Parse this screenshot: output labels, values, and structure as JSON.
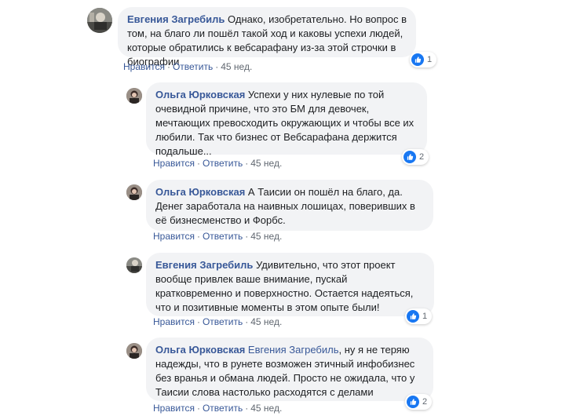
{
  "comments": [
    {
      "author": "Евгения Загребиль",
      "mention": "",
      "text": " Однако, изобретательно. Но вопрос в том, на благо ли пошёл такой ход и каковы успехи людей, которые обратились к вебсарафану из-за этой строчки в биографии",
      "like": "Нравится",
      "reply": "Ответить",
      "time": "45 нед.",
      "reaction_count": "1",
      "reaction_icon": "like-icon"
    },
    {
      "author": "Ольга Юрковская",
      "mention": "",
      "text": " Успехи у них нулевые по той очевидной причине, что это БМ для девочек, мечтающих превосходить окружающих и чтобы все их любили. Так что бизнес от Вебсарафана держится подальше...",
      "like": "Нравится",
      "reply": "Ответить",
      "time": "45 нед.",
      "reaction_count": "2",
      "reaction_icon": "like-icon"
    },
    {
      "author": "Ольга Юрковская",
      "mention": "",
      "text": " А Таисии он пошёл на благо, да. Денег заработала на наивных лошицах, поверивших в её бизнесменство и Форбс.",
      "like": "Нравится",
      "reply": "Ответить",
      "time": "45 нед.",
      "reaction_count": "",
      "reaction_icon": ""
    },
    {
      "author": "Евгения Загребиль",
      "mention": "",
      "text": " Удивительно, что этот проект вообще привлек ваше внимание, пускай кратковременно и поверхностно. Остается надеяться, что и позитивные моменты в этом опыте были!",
      "like": "Нравится",
      "reply": "Ответить",
      "time": "45 нед.",
      "reaction_count": "1",
      "reaction_icon": "like-icon"
    },
    {
      "author": "Ольга Юрковская",
      "mention": " Евгения Загребиль",
      "text": ", ну я не теряю надежды, что в рунете возможен этичный инфобизнес без вранья и обмана людей. Просто не ожидала, что у Таисии слова настолько расходятся с делами",
      "like": "Нравится",
      "reply": "Ответить",
      "time": "45 нед.",
      "reaction_count": "2",
      "reaction_icon": "like-icon"
    }
  ],
  "colors": {
    "link": "#385898",
    "bubble": "#f2f3f5",
    "like_badge": "#1877f2",
    "meta": "#606770"
  }
}
